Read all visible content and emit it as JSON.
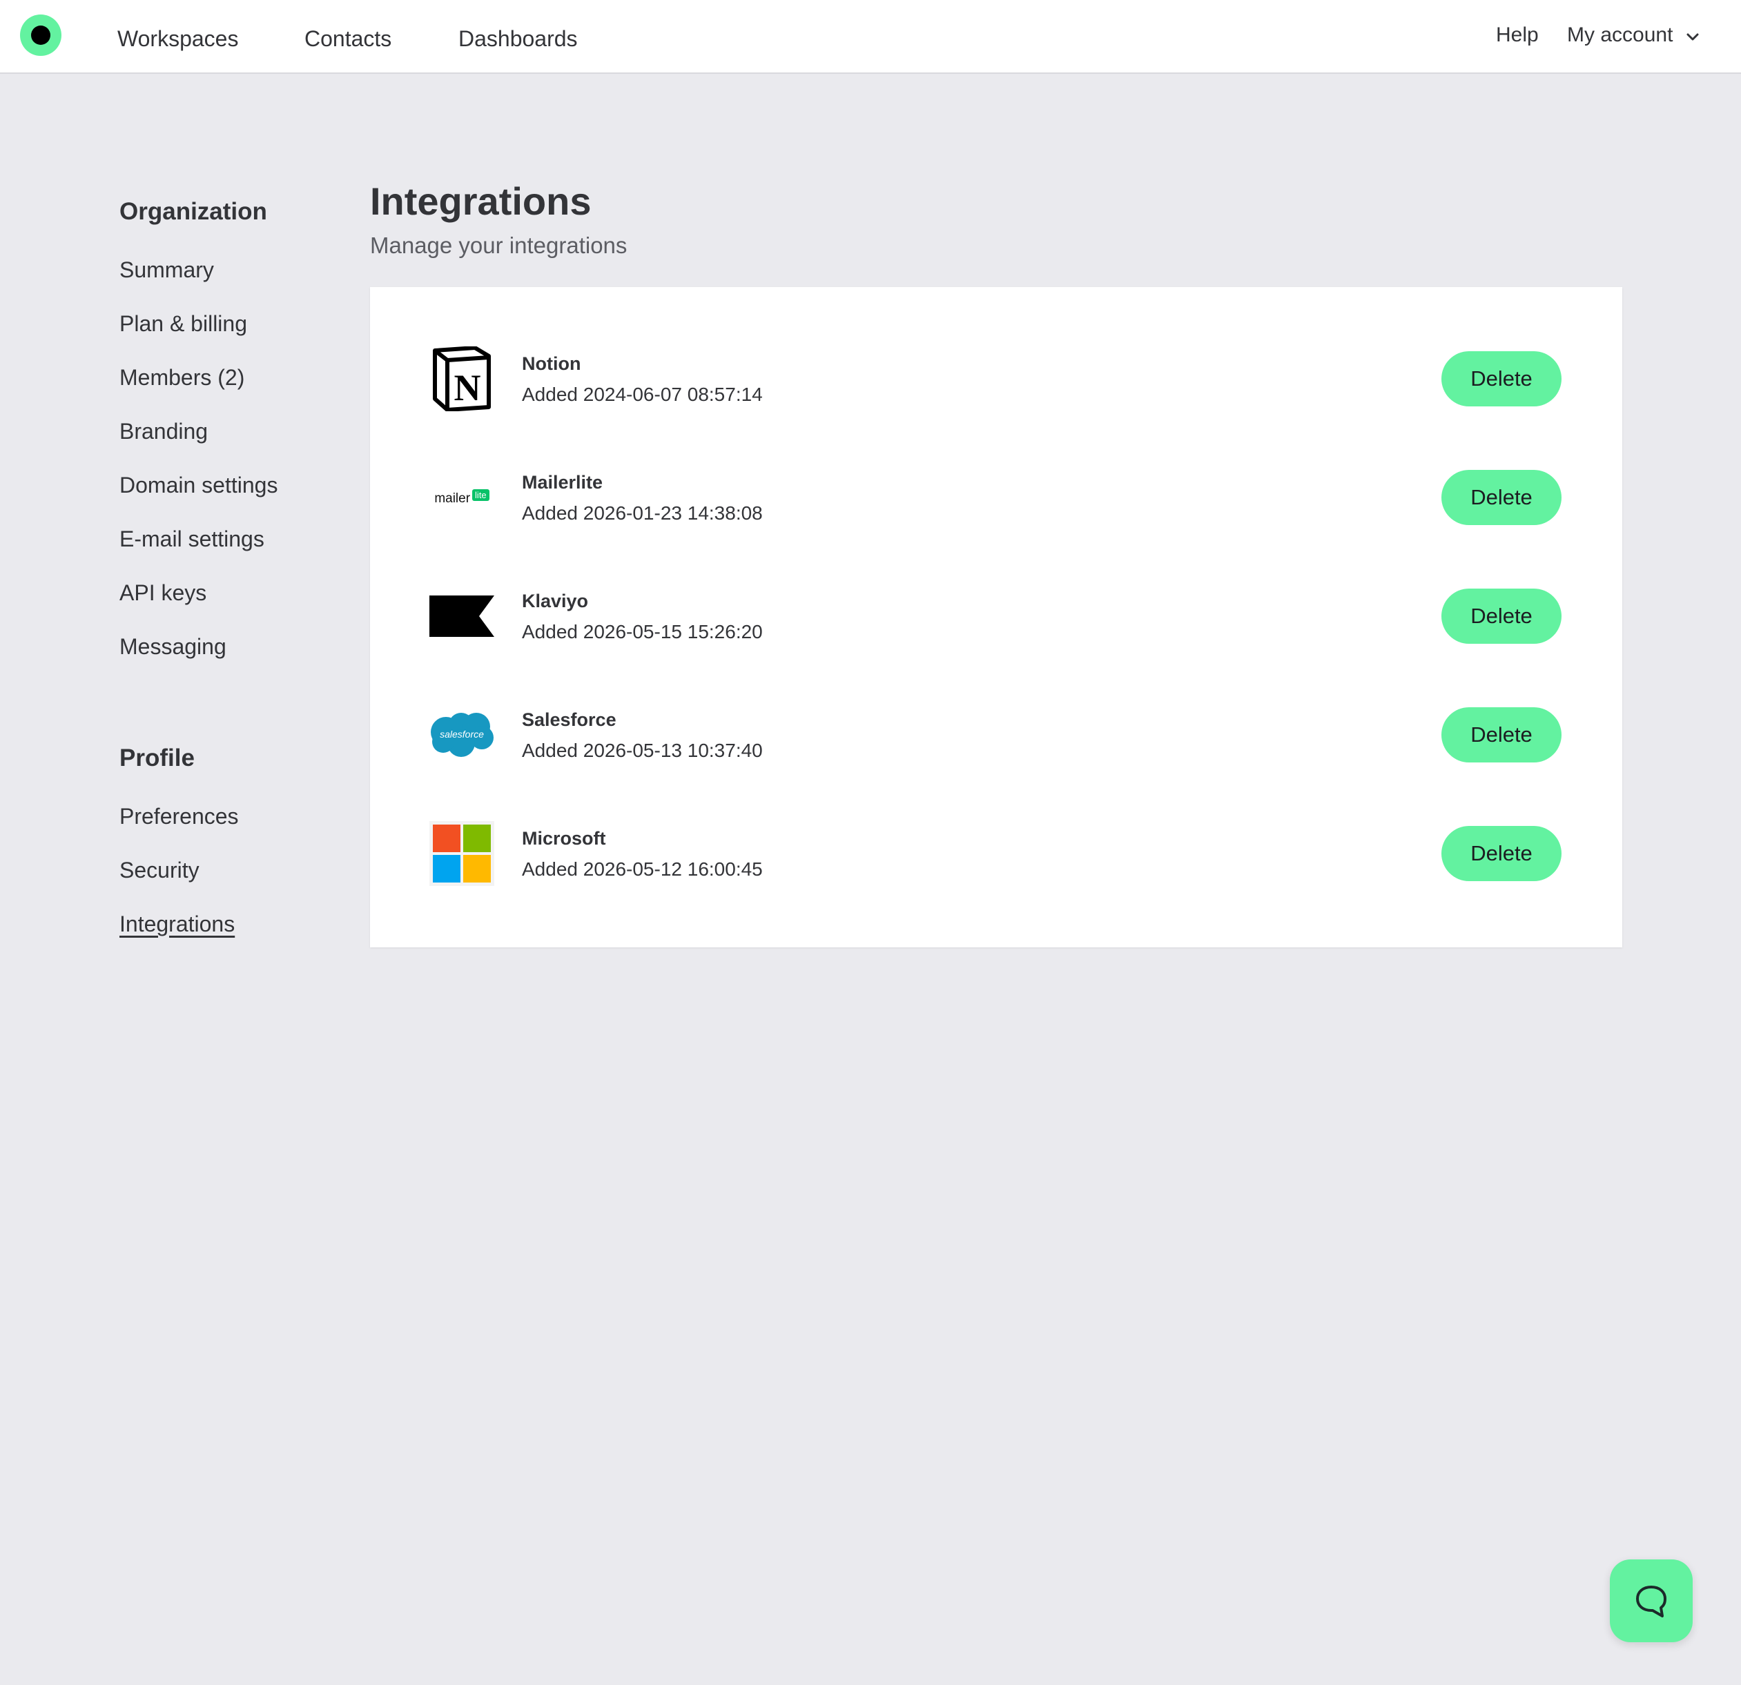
{
  "nav": {
    "links": [
      "Workspaces",
      "Contacts",
      "Dashboards"
    ],
    "help": "Help",
    "account": "My account",
    "account_icon": "chevron-down-icon"
  },
  "sidebar": {
    "organization": {
      "heading": "Organization",
      "items": [
        "Summary",
        "Plan & billing",
        "Members (2)",
        "Branding",
        "Domain settings",
        "E-mail settings",
        "API keys",
        "Messaging"
      ]
    },
    "profile": {
      "heading": "Profile",
      "items": [
        "Preferences",
        "Security",
        "Integrations"
      ],
      "active": "Integrations"
    }
  },
  "main": {
    "title": "Integrations",
    "subtitle": "Manage your integrations",
    "integrations": [
      {
        "name": "Notion",
        "added": "Added 2024-06-07 08:57:14",
        "icon": "notion-logo-icon",
        "action": "Delete"
      },
      {
        "name": "Mailerlite",
        "added": "Added 2026-01-23 14:38:08",
        "icon": "mailerlite-logo-icon",
        "logo_text": "mailer",
        "logo_badge": "lite",
        "action": "Delete"
      },
      {
        "name": "Klaviyo",
        "added": "Added 2026-05-15 15:26:20",
        "icon": "klaviyo-logo-icon",
        "action": "Delete"
      },
      {
        "name": "Salesforce",
        "added": "Added 2026-05-13 10:37:40",
        "icon": "salesforce-logo-icon",
        "logo_text": "salesforce",
        "action": "Delete"
      },
      {
        "name": "Microsoft",
        "added": "Added 2026-05-12 16:00:45",
        "icon": "microsoft-logo-icon",
        "action": "Delete"
      }
    ]
  },
  "chat": {
    "icon": "chat-bubble-icon"
  },
  "colors": {
    "accent": "#63f2a0",
    "background": "#eaeaee",
    "text": "#333438",
    "salesforce": "#1798c1",
    "mailerlite": "#09c269"
  }
}
